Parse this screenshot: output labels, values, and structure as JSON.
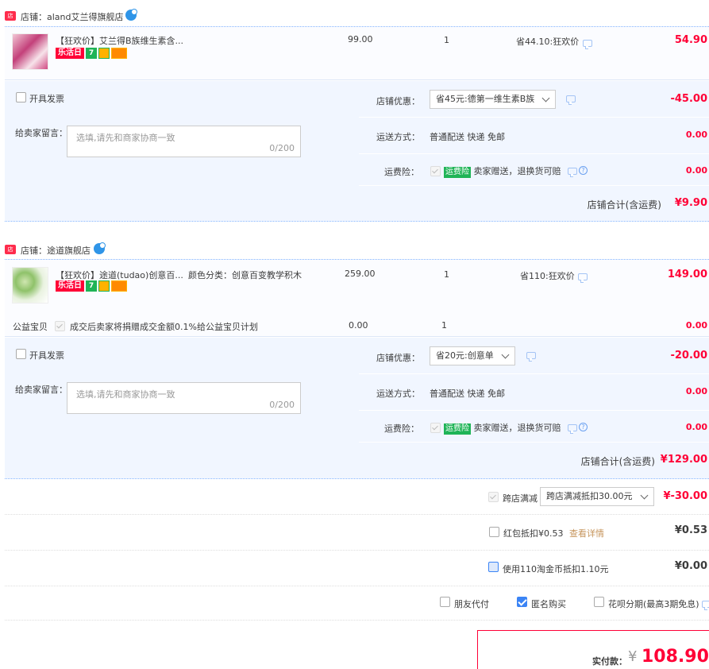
{
  "shops": [
    {
      "name": "店铺：aland艾兰得旗舰店",
      "item": {
        "title": "【狂欢价】艾兰得B族维生素含...",
        "attr": "",
        "tag_festival": "乐活日",
        "price": "99.00",
        "qty": "1",
        "discount": "省44.10:狂欢价",
        "subtotal": "54.90"
      },
      "invoice_label": "开具发票",
      "message_label": "给卖家留言：",
      "message_placeholder": "选填,请先和商家协商一致",
      "message_count": "0/200",
      "coupon_label": "店铺优惠：",
      "coupon_value": "省45元:德第一维生素B族",
      "coupon_amount": "-45.00",
      "shipping_label": "运送方式：",
      "shipping_value": "普通配送 快递 免邮",
      "shipping_amount": "0.00",
      "insurance_label": "运费险：",
      "insurance_tag": "运费险",
      "insurance_text": "卖家赠送，退换货可赔",
      "insurance_amount": "0.00",
      "total_label": "店铺合计(含运费)",
      "total_value": "¥9.90"
    },
    {
      "name": "店铺：途道旗舰店",
      "item": {
        "title": "【狂欢价】途道(tudao)创意百...",
        "attr": "颜色分类：创意百变教学积木",
        "tag_festival": "乐活日",
        "price": "259.00",
        "qty": "1",
        "discount": "省110:狂欢价",
        "subtotal": "149.00"
      },
      "charity_label": "公益宝贝",
      "charity_text": "成交后卖家将捐赠成交金额0.1%给公益宝贝计划",
      "charity_price": "0.00",
      "charity_qty": "1",
      "charity_amount": "0.00",
      "invoice_label": "开具发票",
      "message_label": "给卖家留言：",
      "message_placeholder": "选填,请先和商家协商一致",
      "message_count": "0/200",
      "coupon_label": "店铺优惠：",
      "coupon_value": "省20元:创意单",
      "coupon_amount": "-20.00",
      "shipping_label": "运送方式：",
      "shipping_value": "普通配送 快递 免邮",
      "shipping_amount": "0.00",
      "insurance_label": "运费险：",
      "insurance_tag": "运费险",
      "insurance_text": "卖家赠送，退换货可赔",
      "insurance_amount": "0.00",
      "total_label": "店铺合计(含运费)",
      "total_value": "¥129.00"
    }
  ],
  "cross_store": {
    "label": "跨店满减",
    "select_value": "跨店满减抵扣30.00元",
    "amount": "¥-30.00"
  },
  "red_packet": {
    "label": "红包抵扣¥0.53",
    "link": "查看详情",
    "amount": "¥0.53"
  },
  "coins": {
    "label": "使用110淘金币抵扣1.10元",
    "amount": "¥0.00"
  },
  "options": {
    "friend_pay": "朋友代付",
    "anonymous": "匿名购买",
    "huabei": "花呗分期(最高3期免息)"
  },
  "payment": {
    "label": "实付款：",
    "currency": "¥",
    "amount": "108.90"
  },
  "colors": {
    "accent_red": "#ff0036",
    "panel_blue": "#f1f6ff",
    "brand_blue": "#3b84f5"
  }
}
